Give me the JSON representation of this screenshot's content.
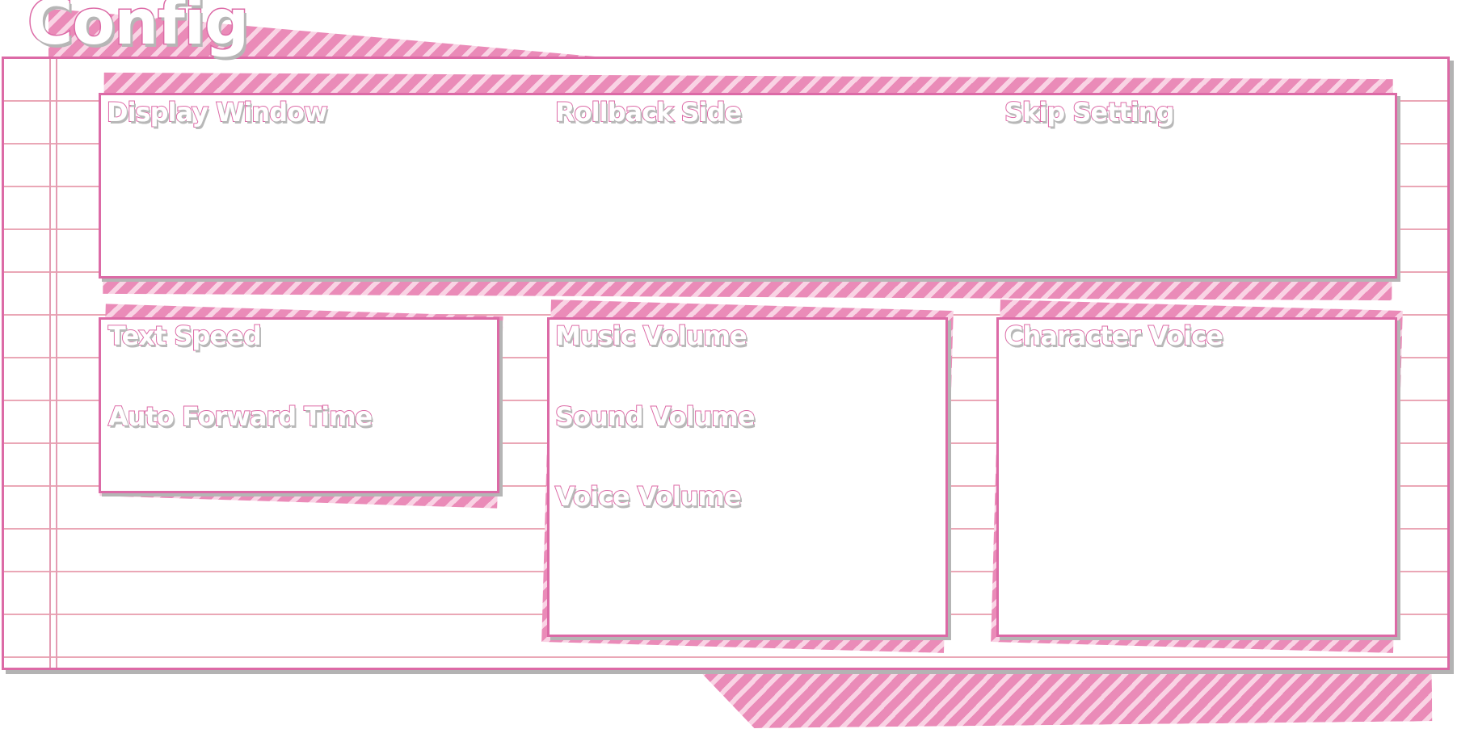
{
  "screen": {
    "title": "Config"
  },
  "sections": {
    "display_window": "Display Window",
    "rollback_side": "Rollback Side",
    "skip_setting": "Skip Setting",
    "text_speed": "Text Speed",
    "auto_forward_time": "Auto Forward Time",
    "music_volume": "Music Volume",
    "sound_volume": "Sound Volume",
    "voice_volume": "Voice Volume",
    "character_voice": "Character Voice"
  },
  "theme": {
    "accent": "#dc6aa6",
    "stripe_dark": "#ea8bb8",
    "stripe_light": "#f9d3e4",
    "rule_line": "#eaa7b6",
    "shadow": "#b5b5b5",
    "background": "#ffffff"
  }
}
